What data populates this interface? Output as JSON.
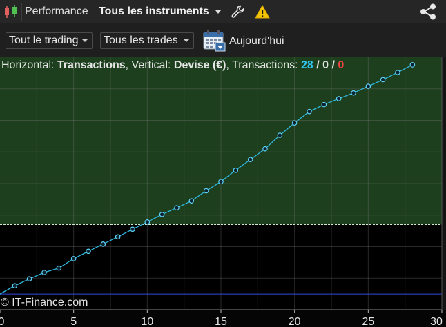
{
  "titlebar": {
    "tab_label": "Performance",
    "instrument_selector": "Tous les instruments",
    "icons": [
      "candlestick-logo-icon",
      "wrench-icon",
      "warning-icon",
      "share-icon"
    ]
  },
  "toolbar": {
    "trading_filter": "Tout le trading",
    "trades_filter": "Tous les trades",
    "period_label": "Aujourd'hui"
  },
  "info": {
    "horizontal_label": "Horizontal:",
    "horizontal_value": "Transactions",
    "sep1": ",",
    "vertical_label": " Vertical:",
    "vertical_value": "Devise (€)",
    "transactions_label": ", Transactions:",
    "count_total": "28",
    "slash1": "/",
    "count_neutral": "0",
    "slash2": "/",
    "count_loss": "0"
  },
  "copyright": "© IT-Finance.com",
  "colors": {
    "positive_zone": "#1d3f1d",
    "negative_zone": "#000000",
    "line": "#2fb8e0",
    "baseline": "#3346e0"
  },
  "chart_data": {
    "type": "line",
    "x": [
      0,
      1,
      2,
      3,
      4,
      5,
      6,
      7,
      8,
      9,
      10,
      11,
      12,
      13,
      14,
      15,
      16,
      17,
      18,
      19,
      20,
      21,
      22,
      23,
      24,
      25,
      26,
      27,
      28
    ],
    "y": [
      0,
      0.26,
      0.48,
      0.68,
      0.82,
      1.12,
      1.35,
      1.58,
      1.81,
      2.05,
      2.28,
      2.52,
      2.73,
      2.95,
      3.27,
      3.56,
      3.92,
      4.26,
      4.6,
      5.03,
      5.42,
      5.78,
      6.0,
      6.19,
      6.37,
      6.58,
      6.79,
      7.02,
      7.26
    ],
    "xticks": [
      0,
      5,
      10,
      15,
      20,
      25,
      30
    ],
    "xlim": [
      0,
      30
    ],
    "ylim": [
      -0.5,
      7.5
    ],
    "reference_level": 2.2,
    "grid": true
  }
}
